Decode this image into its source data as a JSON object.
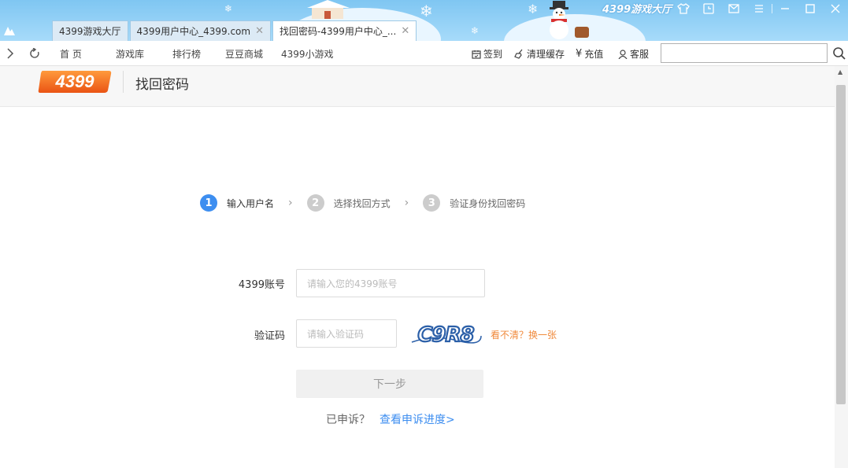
{
  "browser": {
    "brand": "4399游戏大厅",
    "tabs": [
      {
        "label": "4399游戏大厅",
        "active": false,
        "closable": false
      },
      {
        "label": "4399用户中心_4399.com",
        "active": false,
        "closable": true
      },
      {
        "label": "找回密码-4399用户中心_...",
        "active": true,
        "closable": true
      }
    ],
    "nav_links": [
      "首 页",
      "游戏库",
      "排行榜",
      "豆豆商城",
      "4399小游戏"
    ],
    "tools": {
      "signin": "签到",
      "clear_cache": "清理缓存",
      "recharge": "充值",
      "service": "客服"
    },
    "url_value": ""
  },
  "page": {
    "logo_text": "4399",
    "title": "找回密码",
    "steps": [
      {
        "num": "1",
        "label": "输入用户名",
        "active": true
      },
      {
        "num": "2",
        "label": "选择找回方式",
        "active": false
      },
      {
        "num": "3",
        "label": "验证身份找回密码",
        "active": false
      }
    ],
    "form": {
      "account_label": "4399账号",
      "account_placeholder": "请输入您的4399账号",
      "captcha_label": "验证码",
      "captcha_placeholder": "请输入验证码",
      "captcha_text": "C9R8",
      "captcha_refresh": "看不清？换一张",
      "next_button": "下一步"
    },
    "appeal": {
      "prefix": "已申诉？",
      "link": "查看申诉进度>"
    }
  },
  "colors": {
    "accent_blue": "#3d8ef0",
    "captcha_link": "#f08a3c",
    "logo_orange": "#f26b1d",
    "titlebar": "#8fd0f6"
  }
}
